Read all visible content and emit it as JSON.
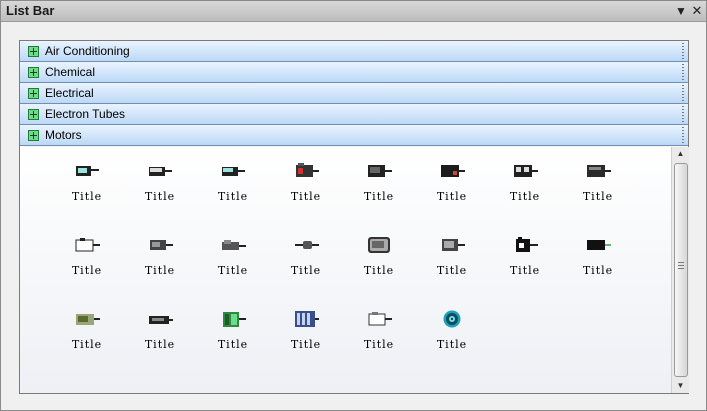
{
  "window": {
    "title": "List Bar",
    "dropdown_icon": "chevron-down-icon",
    "close_icon": "close-icon",
    "dropdown_glyph": "▼",
    "close_glyph": "✕"
  },
  "categories": [
    {
      "label": "Air Conditioning",
      "icon": "expand-plus-icon"
    },
    {
      "label": "Chemical",
      "icon": "expand-plus-icon"
    },
    {
      "label": "Electrical",
      "icon": "expand-plus-icon"
    },
    {
      "label": "Electron Tubes",
      "icon": "expand-plus-icon"
    },
    {
      "label": "Motors",
      "icon": "expand-plus-icon"
    }
  ],
  "items": [
    {
      "caption": "Title",
      "icon": "motor-icon"
    },
    {
      "caption": "Title",
      "icon": "motor-icon"
    },
    {
      "caption": "Title",
      "icon": "motor-icon"
    },
    {
      "caption": "Title",
      "icon": "motor-icon"
    },
    {
      "caption": "Title",
      "icon": "motor-icon"
    },
    {
      "caption": "Title",
      "icon": "motor-icon"
    },
    {
      "caption": "Title",
      "icon": "motor-icon"
    },
    {
      "caption": "Title",
      "icon": "motor-icon"
    },
    {
      "caption": "Title",
      "icon": "motor-icon"
    },
    {
      "caption": "Title",
      "icon": "motor-icon"
    },
    {
      "caption": "Title",
      "icon": "motor-icon"
    },
    {
      "caption": "Title",
      "icon": "motor-icon"
    },
    {
      "caption": "Title",
      "icon": "motor-icon"
    },
    {
      "caption": "Title",
      "icon": "motor-icon"
    },
    {
      "caption": "Title",
      "icon": "motor-icon"
    },
    {
      "caption": "Title",
      "icon": "motor-icon"
    },
    {
      "caption": "Title",
      "icon": "motor-icon"
    },
    {
      "caption": "Title",
      "icon": "motor-icon"
    },
    {
      "caption": "Title",
      "icon": "motor-icon"
    },
    {
      "caption": "Title",
      "icon": "motor-icon"
    },
    {
      "caption": "Title",
      "icon": "motor-icon"
    },
    {
      "caption": "Title",
      "icon": "turbine-icon"
    }
  ],
  "scrollbar": {
    "up_glyph": "▲",
    "down_glyph": "▼"
  },
  "colors": {
    "header_top": "#eaf4ff",
    "header_bottom": "#bcd8f6",
    "expand_icon": "#6fdc8c"
  }
}
